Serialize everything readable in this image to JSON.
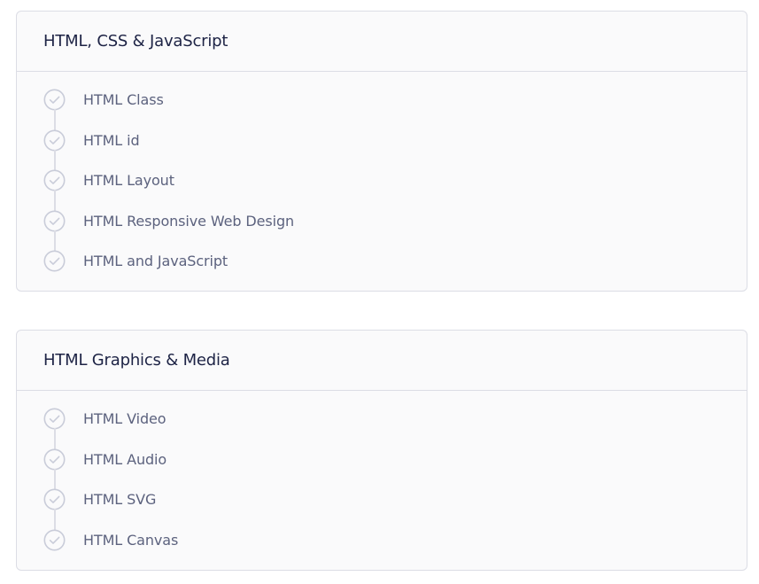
{
  "sections": [
    {
      "title": "HTML, CSS & JavaScript",
      "lessons": [
        {
          "label": "HTML Class",
          "icon": "check-circle-icon"
        },
        {
          "label": "HTML id",
          "icon": "check-circle-icon"
        },
        {
          "label": "HTML Layout",
          "icon": "check-circle-icon"
        },
        {
          "label": "HTML Responsive Web Design",
          "icon": "check-circle-icon"
        },
        {
          "label": "HTML and JavaScript",
          "icon": "check-circle-icon"
        }
      ]
    },
    {
      "title": "HTML Graphics & Media",
      "lessons": [
        {
          "label": "HTML Video",
          "icon": "check-circle-icon"
        },
        {
          "label": "HTML Audio",
          "icon": "check-circle-icon"
        },
        {
          "label": "HTML SVG",
          "icon": "check-circle-icon"
        },
        {
          "label": "HTML Canvas",
          "icon": "check-circle-icon"
        }
      ]
    }
  ],
  "colors": {
    "card_background": "#fafafb",
    "border": "#dcdde5",
    "title_text": "#1d2345",
    "lesson_text": "#5c627e",
    "icon_stroke": "#c9ccd9"
  }
}
